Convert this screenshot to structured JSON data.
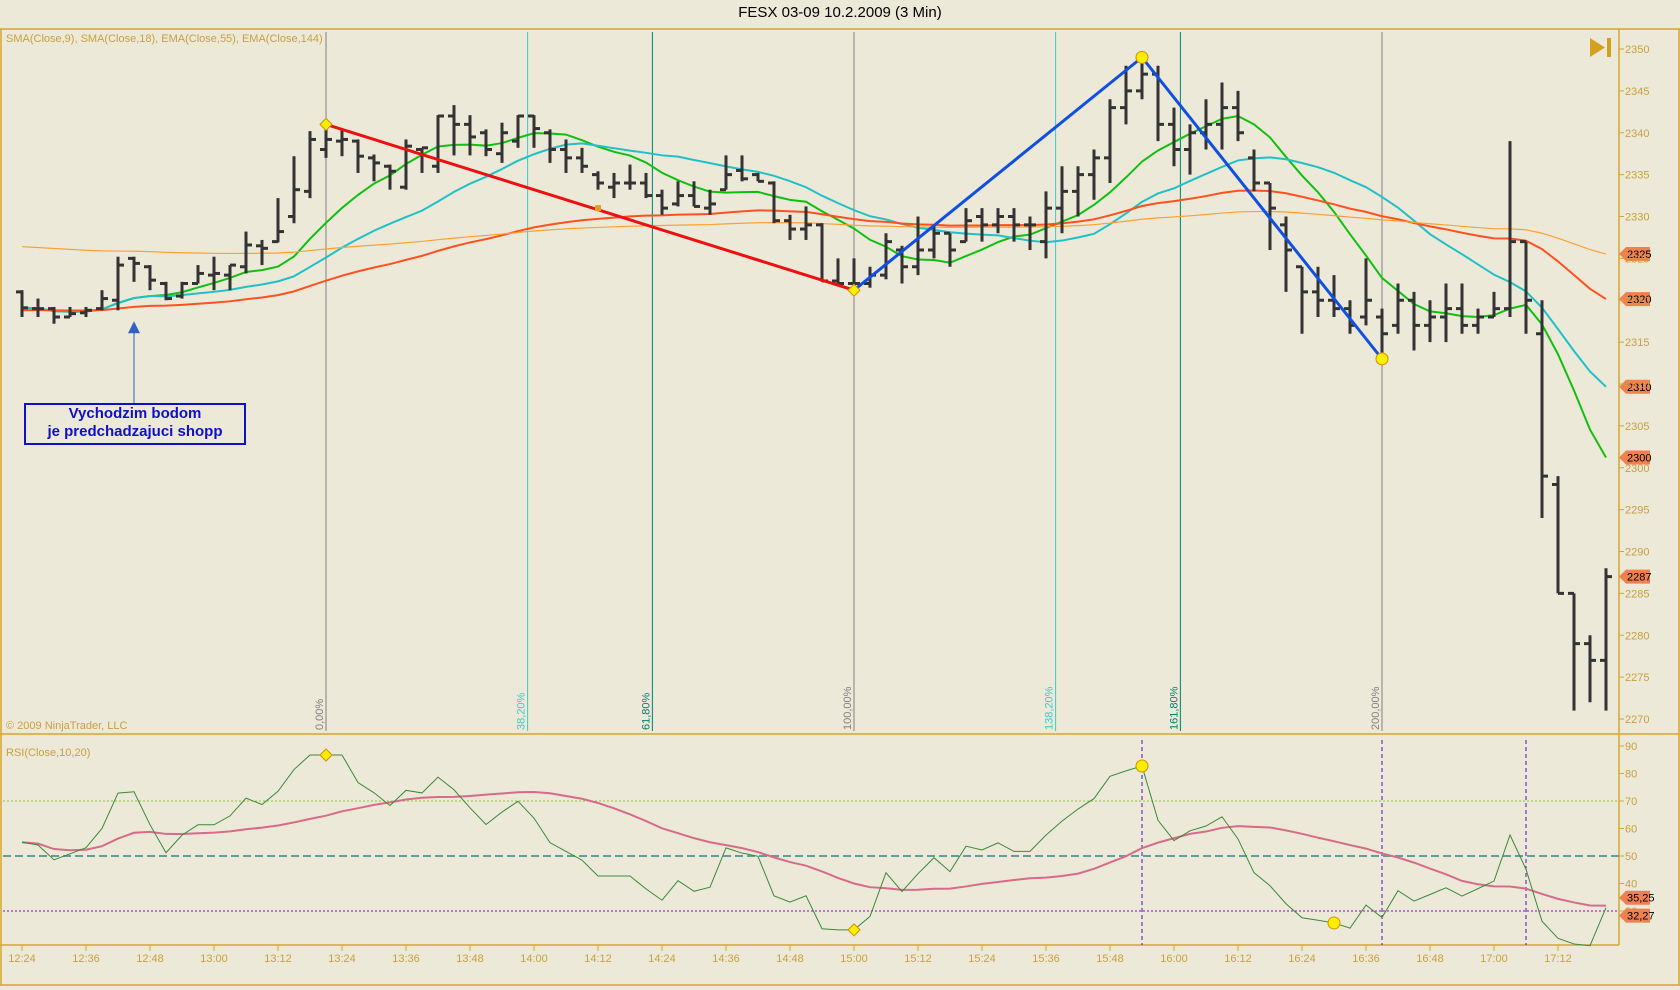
{
  "window": {
    "title": "FESX 03-09  10.2.2009 (3 Min)"
  },
  "colors": {
    "background": "#ece9d8",
    "axis": "#d4a830",
    "bars": "#333333",
    "sma9": "#10c010",
    "sma18": "#20c0c8",
    "ema55": "#ff5020",
    "ema144": "#ffa030",
    "swing_down": "#ee1010",
    "swing_up": "#1050e0",
    "rsi": "#3a8a3a",
    "rsi_avg": "#d86a8a",
    "tag": "#f08050"
  },
  "icons": {
    "scroll_end": "skip-to-end-icon"
  },
  "chart_data": [
    {
      "type": "ohlc",
      "panel": "price",
      "indicator_label": "SMA(Close,9), SMA(Close,18), EMA(Close,55), EMA(Close,144)",
      "copyright": "© 2009 NinjaTrader, LLC",
      "bar_interval_min": 3,
      "first_bar_time": "12:24",
      "ylim": [
        2268,
        2352
      ],
      "yticks": [
        2270,
        2275,
        2280,
        2285,
        2290,
        2295,
        2300,
        2305,
        2310,
        2315,
        2320,
        2325,
        2330,
        2335,
        2340,
        2345,
        2350
      ],
      "xticks": [
        "12:24",
        "12:36",
        "12:48",
        "13:00",
        "13:12",
        "13:24",
        "13:36",
        "13:48",
        "14:00",
        "14:12",
        "14:24",
        "14:36",
        "14:48",
        "15:00",
        "15:12",
        "15:24",
        "15:36",
        "15:48",
        "16:00",
        "16:12",
        "16:24",
        "16:36",
        "16:48",
        "17:00",
        "17:12"
      ],
      "bars_ohlc": [
        [
          2321,
          2321.2,
          2318,
          2319.1
        ],
        [
          2319,
          2320.2,
          2318,
          2319
        ],
        [
          2319,
          2319.2,
          2317.2,
          2318
        ],
        [
          2318,
          2319.2,
          2318,
          2318.4
        ],
        [
          2318.5,
          2319.2,
          2318,
          2318.8
        ],
        [
          2319,
          2321.2,
          2318.8,
          2320.2
        ],
        [
          2320,
          2325.2,
          2318.8,
          2324.2
        ],
        [
          2325,
          2325.2,
          2322.2,
          2324.4
        ],
        [
          2324,
          2324.2,
          2321.2,
          2322.4
        ],
        [
          2322,
          2322.2,
          2320,
          2320.2
        ],
        [
          2320.5,
          2322.2,
          2320.2,
          2322
        ],
        [
          2322,
          2324.2,
          2322,
          2323.2
        ],
        [
          2323,
          2325.2,
          2321.2,
          2323.2
        ],
        [
          2323,
          2324.2,
          2321.2,
          2324.2
        ],
        [
          2324,
          2328.2,
          2323.2,
          2326.6
        ],
        [
          2326.5,
          2327.2,
          2324.2,
          2326.2
        ],
        [
          2327,
          2332.2,
          2326.9,
          2328.2
        ],
        [
          2330,
          2337.2,
          2329.2,
          2333.2
        ],
        [
          2333,
          2340.2,
          2332.2,
          2339.2
        ],
        [
          2338,
          2341.1,
          2337,
          2339.2
        ],
        [
          2339,
          2340.4,
          2337.2,
          2339.2
        ],
        [
          2339,
          2339.2,
          2335.2,
          2337.2
        ],
        [
          2337,
          2337.4,
          2334.2,
          2336.4
        ],
        [
          2336,
          2336.2,
          2333.2,
          2335.4
        ],
        [
          2333.5,
          2339.2,
          2333.2,
          2338.4
        ],
        [
          2338,
          2338.2,
          2335.2,
          2338.2
        ],
        [
          2336,
          2342.1,
          2335.2,
          2342
        ],
        [
          2342,
          2343.3,
          2337.3,
          2341
        ],
        [
          2341,
          2342.1,
          2337.3,
          2339.5
        ],
        [
          2340,
          2340.4,
          2337.2,
          2338
        ],
        [
          2337.5,
          2341.2,
          2336.4,
          2340
        ],
        [
          2339,
          2342.1,
          2338.2,
          2342
        ],
        [
          2342,
          2342.1,
          2338.2,
          2340.5
        ],
        [
          2340,
          2340.4,
          2336.4,
          2338
        ],
        [
          2338,
          2339.2,
          2335.2,
          2337
        ],
        [
          2337,
          2338.2,
          2335.2,
          2336
        ],
        [
          2335,
          2335.4,
          2333.2,
          2334
        ],
        [
          2333.5,
          2335.2,
          2332.2,
          2334
        ],
        [
          2334,
          2336.2,
          2333.2,
          2334
        ],
        [
          2334,
          2335.2,
          2332.2,
          2332.5
        ],
        [
          2332.5,
          2333.2,
          2330.2,
          2331
        ],
        [
          2331.5,
          2334.2,
          2331.2,
          2332.5
        ],
        [
          2332.5,
          2334.2,
          2331.2,
          2331.2
        ],
        [
          2331,
          2333.2,
          2330.2,
          2331.5
        ],
        [
          2333.2,
          2337.3,
          2333.2,
          2335
        ],
        [
          2335.5,
          2337.3,
          2334.2,
          2334.5
        ],
        [
          2335,
          2335.2,
          2334.2,
          2334.2
        ],
        [
          2334,
          2334.2,
          2329.2,
          2329.5
        ],
        [
          2329.5,
          2330.2,
          2327.2,
          2328.5
        ],
        [
          2328.5,
          2331.2,
          2327.2,
          2329
        ],
        [
          2329,
          2329.2,
          2322.2,
          2322.3
        ],
        [
          2322.3,
          2325,
          2322,
          2322
        ],
        [
          2322,
          2325,
          2321.2,
          2322
        ],
        [
          2322,
          2324,
          2321.5,
          2323
        ],
        [
          2323,
          2328,
          2322.5,
          2327
        ],
        [
          2326,
          2326.5,
          2322,
          2324
        ],
        [
          2324,
          2330,
          2323,
          2326
        ],
        [
          2326,
          2329,
          2325,
          2328
        ],
        [
          2328,
          2328,
          2324,
          2326
        ],
        [
          2327,
          2331,
          2327,
          2329.5
        ],
        [
          2330,
          2331,
          2327,
          2329
        ],
        [
          2329,
          2331,
          2328,
          2330
        ],
        [
          2330,
          2331,
          2327,
          2329
        ],
        [
          2329,
          2330,
          2326,
          2329
        ],
        [
          2327,
          2333,
          2325,
          2331
        ],
        [
          2331,
          2336,
          2328,
          2333
        ],
        [
          2333,
          2336,
          2330,
          2335
        ],
        [
          2335,
          2338,
          2332,
          2337
        ],
        [
          2337,
          2344,
          2334,
          2343
        ],
        [
          2343,
          2348,
          2341,
          2345
        ],
        [
          2345,
          2349,
          2344,
          2347
        ],
        [
          2347,
          2348,
          2339,
          2341
        ],
        [
          2341,
          2343,
          2336,
          2338
        ],
        [
          2338,
          2341,
          2335,
          2340
        ],
        [
          2340,
          2344,
          2338,
          2341
        ],
        [
          2341,
          2346,
          2338,
          2343
        ],
        [
          2343,
          2345,
          2339,
          2340
        ],
        [
          2337,
          2338,
          2333,
          2334
        ],
        [
          2334,
          2334,
          2326,
          2331
        ],
        [
          2329,
          2330,
          2321,
          2326
        ],
        [
          2324,
          2324,
          2316,
          2321
        ],
        [
          2321,
          2324,
          2318,
          2320
        ],
        [
          2320,
          2323,
          2318,
          2319
        ],
        [
          2319,
          2320,
          2316,
          2317
        ],
        [
          2318,
          2325,
          2317,
          2320
        ],
        [
          2318,
          2319,
          2313,
          2316
        ],
        [
          2317,
          2322,
          2316,
          2320
        ],
        [
          2320,
          2321,
          2314,
          2317
        ],
        [
          2317,
          2320,
          2315,
          2318
        ],
        [
          2318,
          2322,
          2315,
          2319
        ],
        [
          2319,
          2322,
          2316,
          2317
        ],
        [
          2317,
          2319,
          2316,
          2318
        ],
        [
          2318,
          2321,
          2318,
          2319
        ],
        [
          2319,
          2339,
          2318,
          2327
        ],
        [
          2327,
          2327,
          2316,
          2320
        ],
        [
          2316,
          2320,
          2294,
          2299
        ],
        [
          2298,
          2299,
          2285,
          2285
        ],
        [
          2285,
          2285,
          2271,
          2279
        ],
        [
          2279,
          2280,
          2272,
          2277
        ],
        [
          2277,
          2288,
          2271,
          2287
        ]
      ],
      "moving_averages": [
        {
          "name": "SMA(Close,9)",
          "kind": "sma",
          "period": 9,
          "last_tag": "2300"
        },
        {
          "name": "SMA(Close,18)",
          "kind": "sma",
          "period": 18,
          "last_tag": "2310"
        },
        {
          "name": "EMA(Close,55)",
          "kind": "ema",
          "period": 55,
          "last_tag": "2320"
        },
        {
          "name": "EMA(Close,144)",
          "kind": "ema",
          "period": 144,
          "last_tag": "2325"
        }
      ],
      "last_price_tag": "2287",
      "swing_lines": [
        {
          "from": {
            "time": "13:21",
            "price": 2341
          },
          "to": {
            "time": "15:00",
            "price": 2321.2
          },
          "color": "red"
        },
        {
          "from": {
            "time": "15:00",
            "price": 2321.2
          },
          "to": {
            "time": "15:54",
            "price": 2349
          },
          "color": "blue"
        },
        {
          "from": {
            "time": "15:54",
            "price": 2349
          },
          "to": {
            "time": "16:39",
            "price": 2313
          },
          "color": "blue"
        }
      ],
      "fib_time_lines": [
        {
          "label": "0,00%",
          "bar_offset": 0,
          "color": "#808080"
        },
        {
          "label": "38,20%",
          "bar_offset": 12.6,
          "color": "#40c8c8"
        },
        {
          "label": "61,80%",
          "bar_offset": 20.4,
          "color": "#008070"
        },
        {
          "label": "100,00%",
          "bar_offset": 33,
          "color": "#808080"
        },
        {
          "label": "138,20%",
          "bar_offset": 45.6,
          "color": "#40c8c8"
        },
        {
          "label": "161,80%",
          "bar_offset": 53.4,
          "color": "#008070"
        },
        {
          "label": "200,00%",
          "bar_offset": 66,
          "color": "#808080"
        }
      ],
      "fib_start_time": "13:21",
      "annotation": {
        "line1": "Vychodzim bodom",
        "line2": "je predchadzajuci shopp",
        "arrow_time": "12:45",
        "arrow_price": 2317.5
      }
    },
    {
      "type": "line",
      "panel": "rsi",
      "indicator_label": "RSI(Close,10,20)",
      "period": 10,
      "smooth": 20,
      "ylim": [
        20,
        94
      ],
      "yticks": [
        30,
        40,
        50,
        60,
        70,
        80,
        90
      ],
      "levels": [
        {
          "value": 70,
          "style": "dotted",
          "color": "#90c040"
        },
        {
          "value": 50,
          "style": "dashed",
          "color": "#5f9ea0"
        },
        {
          "value": 30,
          "style": "dotted",
          "color": "#9900cc"
        }
      ],
      "tags": [
        "35,25",
        "32,27"
      ],
      "markers_times": [
        "13:21",
        "15:00",
        "15:54",
        "16:30"
      ],
      "vertical_marker_times": [
        "15:54",
        "16:39",
        "17:06"
      ]
    }
  ]
}
